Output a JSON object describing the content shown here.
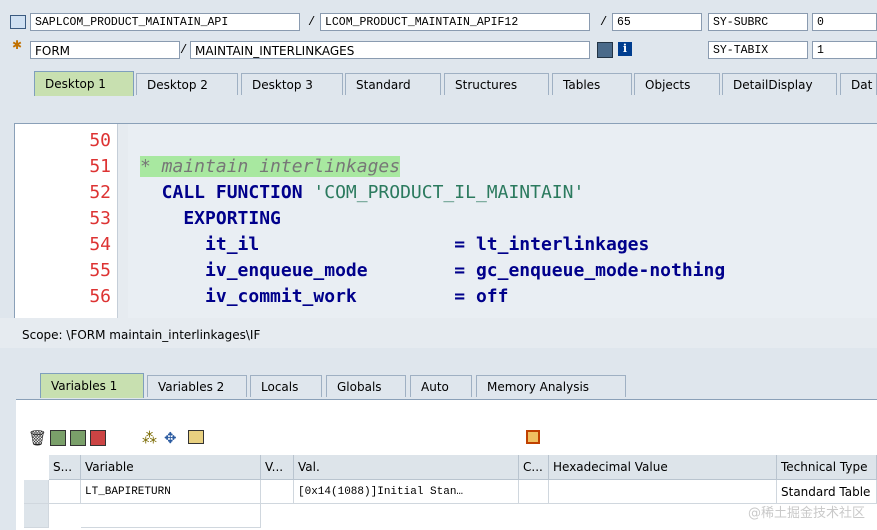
{
  "header": {
    "program": "SAPLCOM_PRODUCT_MAINTAIN_API",
    "include": "LCOM_PRODUCT_MAINTAIN_APIF12",
    "line": "65",
    "sy_subrc_label": "SY-SUBRC",
    "sy_subrc_value": "0",
    "event_type": "FORM",
    "event_name": "MAINTAIN_INTERLINKAGES",
    "sy_tabix_label": "SY-TABIX",
    "sy_tabix_value": "1",
    "sep": "/"
  },
  "tabs": [
    {
      "label": "Desktop 1",
      "active": true
    },
    {
      "label": "Desktop 2"
    },
    {
      "label": "Desktop 3"
    },
    {
      "label": "Standard"
    },
    {
      "label": "Structures"
    },
    {
      "label": "Tables"
    },
    {
      "label": "Objects"
    },
    {
      "label": "DetailDisplay"
    },
    {
      "label": "Dat"
    }
  ],
  "code": {
    "line_numbers": [
      "50",
      "51",
      "52",
      "53",
      "54",
      "55",
      "56"
    ],
    "lines": [
      {
        "parts": []
      },
      {
        "parts": [
          {
            "t": "* maintain interlinkages",
            "c": "cmt"
          }
        ]
      },
      {
        "parts": [
          {
            "t": "  CALL FUNCTION ",
            "c": "kw"
          },
          {
            "t": "'COM_PRODUCT_IL_MAINTAIN'",
            "c": "str"
          }
        ]
      },
      {
        "parts": [
          {
            "t": "    EXPORTING",
            "c": "kw"
          }
        ]
      },
      {
        "parts": [
          {
            "t": "      it_il                  = lt_interlinkages",
            "c": "kw"
          }
        ]
      },
      {
        "parts": [
          {
            "t": "      iv_enqueue_mode        = gc_enqueue_mode-nothing",
            "c": "kw"
          }
        ]
      },
      {
        "parts": [
          {
            "t": "      iv_commit_work         = off",
            "c": "kw"
          }
        ]
      }
    ]
  },
  "scope": "Scope: \\FORM maintain_interlinkages\\IF",
  "var_tabs": [
    {
      "label": "Variables 1",
      "active": true
    },
    {
      "label": "Variables 2"
    },
    {
      "label": "Locals"
    },
    {
      "label": "Globals"
    },
    {
      "label": "Auto"
    },
    {
      "label": "Memory Analysis"
    }
  ],
  "grid": {
    "headers": [
      "S...",
      "Variable",
      "V...",
      "Val.",
      "C...",
      "Hexadecimal Value",
      "Technical Type"
    ],
    "rows": [
      [
        "",
        "LT_BAPIRETURN",
        "",
        "[0x14(1088)]Initial Stan…",
        "",
        "",
        "Standard Table"
      ],
      [
        "",
        "",
        "",
        "",
        "",
        "",
        ""
      ]
    ]
  },
  "watermark": "@稀土掘金技术社区"
}
